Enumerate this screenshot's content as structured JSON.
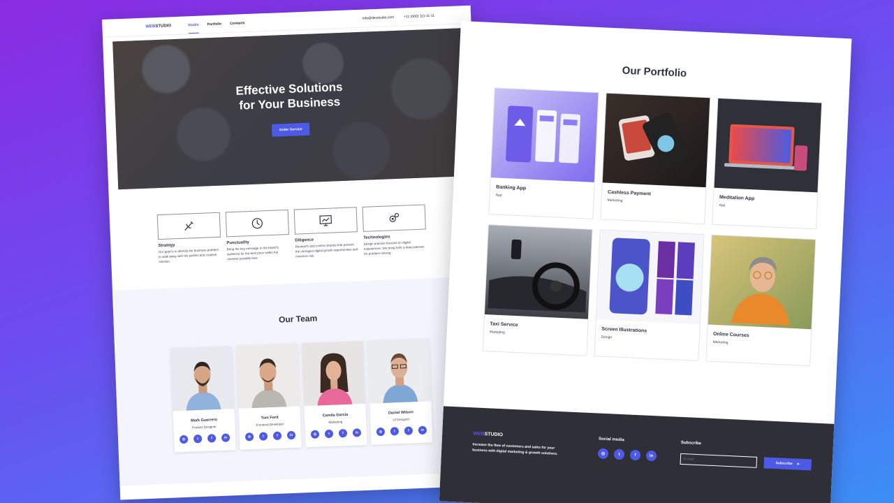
{
  "header": {
    "logo_accent": "WEB",
    "logo_rest": "STUDIO",
    "nav": [
      "Studio",
      "Portfolio",
      "Contacts"
    ],
    "email": "info@devstudio.com",
    "phone": "+11 (000) 111-11-11"
  },
  "hero": {
    "title_line1": "Effective Solutions",
    "title_line2": "for Your Business",
    "button": "Order Service"
  },
  "features": [
    {
      "title": "Strategy",
      "text": "Our goal is to identify the business problem to walk away with the perfect and creative solution.",
      "icon": "antenna-icon"
    },
    {
      "title": "Punctuality",
      "text": "Bring the key message to the brand's audience for the best price within the shortest possible time.",
      "icon": "clock-icon"
    },
    {
      "title": "Diligence",
      "text": "Research and confirm brands that present the strongest digital growth opportunities and minimize risk.",
      "icon": "monitor-icon"
    },
    {
      "title": "Technologies",
      "text": "Design practice focused on digital experiences. We bring forth a deep passion for problem-solving.",
      "icon": "gears-icon"
    }
  ],
  "team": {
    "title": "Our Team",
    "members": [
      {
        "name": "Mark Guerrero",
        "role": "Product Designer"
      },
      {
        "name": "Tom Ford",
        "role": "Frontend Developer"
      },
      {
        "name": "Camila Garcia",
        "role": "Marketing"
      },
      {
        "name": "Daniel Wilson",
        "role": "UI Designer"
      }
    ],
    "socials": [
      "instagram-icon",
      "twitter-icon",
      "facebook-icon",
      "linkedin-icon"
    ]
  },
  "portfolio": {
    "title": "Our Portfolio",
    "items": [
      {
        "title": "Banking App",
        "tag": "App"
      },
      {
        "title": "Cashless Payment",
        "tag": "Marketing"
      },
      {
        "title": "Meditation App",
        "tag": "App"
      },
      {
        "title": "Taxi Service",
        "tag": "Marketing"
      },
      {
        "title": "Screen Illustrations",
        "tag": "Design"
      },
      {
        "title": "Online Courses",
        "tag": "Marketing"
      }
    ]
  },
  "footer": {
    "text": "Increase the flow of customers and sales for your business with digital marketing & growth solutions.",
    "social_heading": "Social media",
    "subscribe_heading": "Subscribe",
    "email_placeholder": "E-mail",
    "subscribe_button": "Subscribe"
  },
  "colors": {
    "accent": "#4d5ae5",
    "dark": "#2f2f37",
    "team_bg": "#f4f4fd"
  }
}
